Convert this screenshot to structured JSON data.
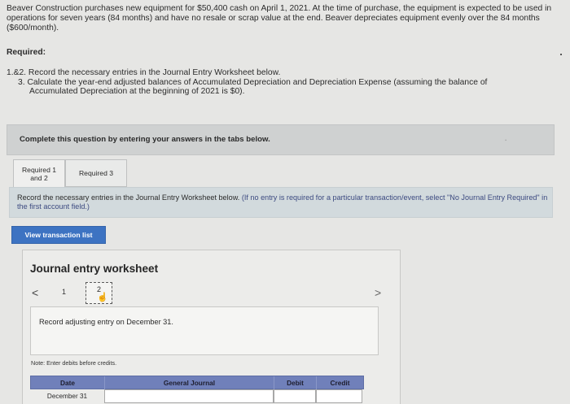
{
  "problem": {
    "text": "Beaver Construction purchases new equipment for $50,400 cash on April 1, 2021. At the time of purchase, the equipment is expected to be used in operations for seven years (84 months) and have no resale or scrap value at the end. Beaver depreciates equipment evenly over the 84 months ($600/month)."
  },
  "required": {
    "heading": "Required:",
    "item1": "1.&2. Record the necessary entries in the Journal Entry Worksheet below.",
    "item3_line1": "3. Calculate the year-end adjusted balances of Accumulated Depreciation and Depreciation Expense (assuming the balance of",
    "item3_line2": "Accumulated Depreciation at the beginning of 2021 is $0)."
  },
  "complete_bar": {
    "text": "Complete this question by entering your answers in the tabs below."
  },
  "tabs": [
    {
      "line1": "Required 1",
      "line2": "and 2"
    },
    {
      "line1": "Required 3"
    }
  ],
  "instructions": {
    "main": "Record the necessary entries in the Journal Entry Worksheet below. ",
    "paren": "(If no entry is required for a particular transaction/event, select \"No Journal Entry Required\" in the first account field.)"
  },
  "view_button": {
    "label": "View transaction list"
  },
  "worksheet": {
    "title": "Journal entry worksheet",
    "prev_glyph": "<",
    "next_glyph": ">",
    "page1": "1",
    "page2": "2",
    "entry_text": "Record adjusting entry on December 31.",
    "note": "Note: Enter debits before credits.",
    "columns": {
      "date": "Date",
      "general_journal": "General Journal",
      "debit": "Debit",
      "credit": "Credit"
    },
    "row": {
      "date": "December 31",
      "general_journal": "",
      "debit": "",
      "credit": ""
    }
  }
}
